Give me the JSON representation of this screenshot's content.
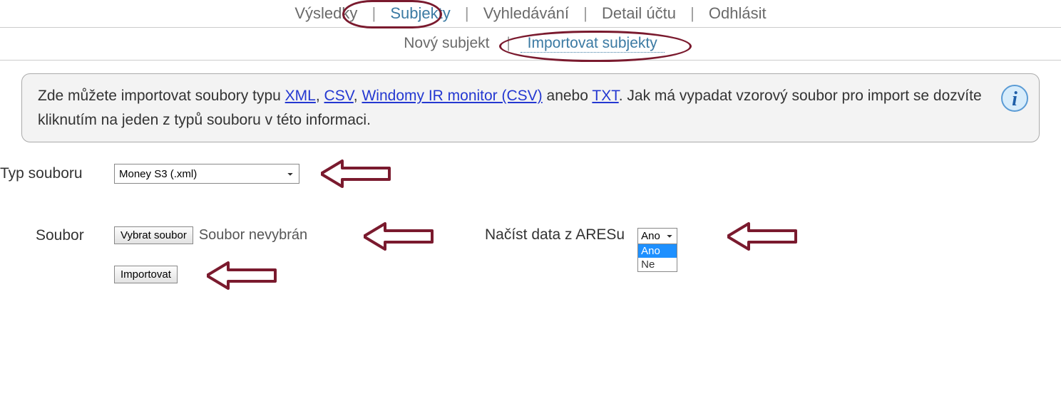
{
  "nav": {
    "items": [
      {
        "label": "Výsledky"
      },
      {
        "label": "Subjekty",
        "active": true
      },
      {
        "label": "Vyhledávání"
      },
      {
        "label": "Detail účtu"
      },
      {
        "label": "Odhlásit"
      }
    ],
    "separator": "|"
  },
  "subnav": {
    "items": [
      {
        "label": "Nový subjekt"
      },
      {
        "label": "Importovat subjekty",
        "active": true
      }
    ],
    "separator": "|"
  },
  "infobox": {
    "text_before": "Zde můžete importovat soubory typu ",
    "link_xml": "XML",
    "sep1": ", ",
    "link_csv": "CSV",
    "sep2": ", ",
    "link_windomy": "Windomy IR monitor (CSV)",
    "sep3": " anebo ",
    "link_txt": "TXT",
    "sep4": ".",
    "text_after": " Jak má vypadat vzorový soubor pro import se dozvíte kliknutím na jeden z typů souboru v této informaci."
  },
  "form": {
    "type_label": "Typ souboru",
    "type_value": "Money S3 (.xml)",
    "file_label": "Soubor",
    "choose_file_btn": "Vybrat soubor",
    "file_status": "Soubor nevybrán",
    "ares_label": "Načíst data z ARESu",
    "ares_value": "Ano",
    "ares_options": {
      "opt1": "Ano",
      "opt2": "Ne"
    },
    "import_btn": "Importovat"
  }
}
